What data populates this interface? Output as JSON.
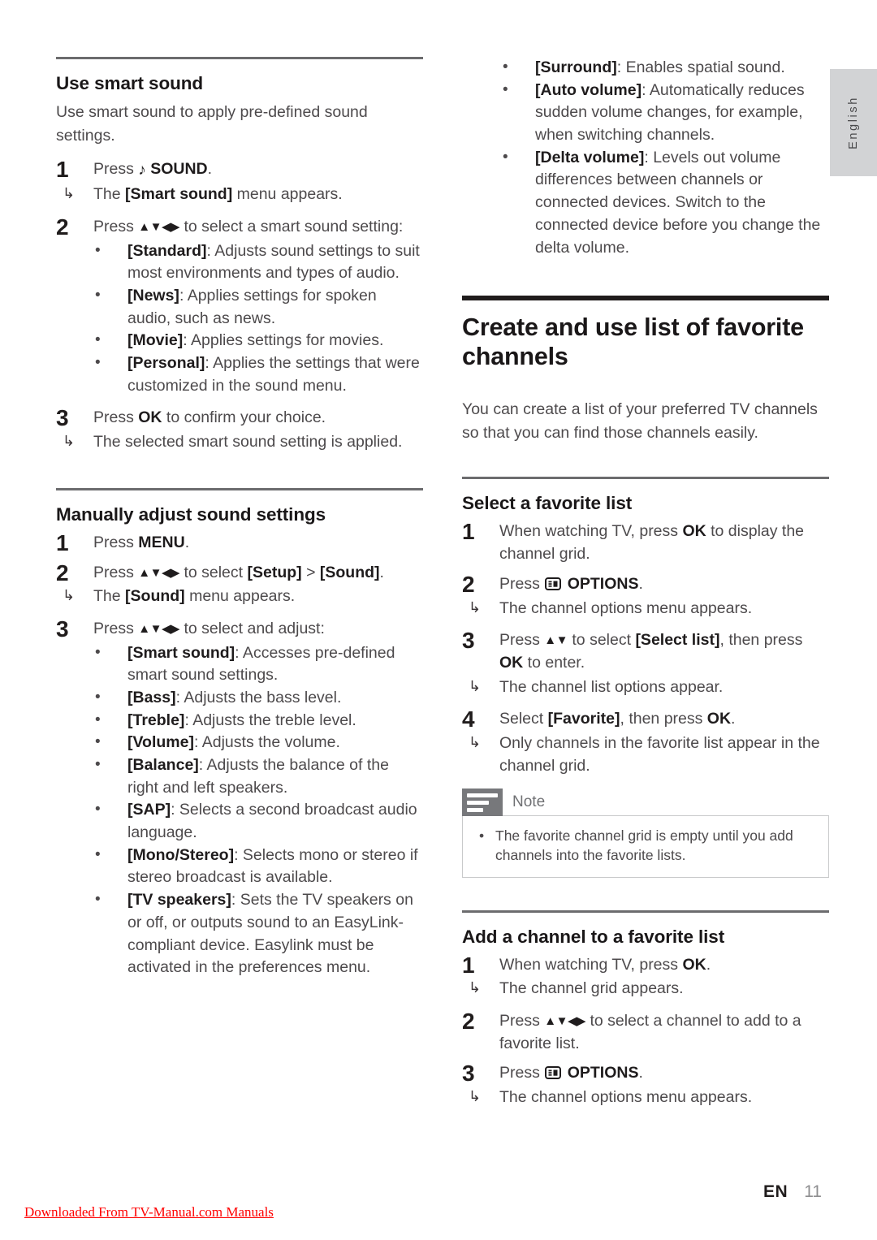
{
  "language_tab": {
    "label": "English"
  },
  "left_column": {
    "section1": {
      "heading": "Use smart sound",
      "intro": "Use smart sound to apply pre-defined sound settings.",
      "steps": [
        {
          "num": "1",
          "text_before": "Press ",
          "icon": "music-note-icon",
          "bold": "SOUND",
          "text_after": ".",
          "result": {
            "pre": "The ",
            "bold": "[Smart sound]",
            "post": " menu appears."
          }
        },
        {
          "num": "2",
          "pre": "Press ",
          "arrows": "▲▼◀▶",
          "post": " to select a smart sound setting:",
          "bullets": [
            {
              "bold": "[Standard]",
              "text": ": Adjusts sound settings to suit most environments and types of audio."
            },
            {
              "bold": "[News]",
              "text": ": Applies settings for spoken audio, such as news."
            },
            {
              "bold": "[Movie]",
              "text": ": Applies settings for movies."
            },
            {
              "bold": "[Personal]",
              "text": ": Applies the settings that were customized in the sound menu."
            }
          ]
        },
        {
          "num": "3",
          "pre": "Press ",
          "bold": "OK",
          "post": " to confirm your choice.",
          "result_plain": "The selected smart sound setting is applied."
        }
      ]
    },
    "section2": {
      "heading": "Manually adjust sound settings",
      "steps": [
        {
          "num": "1",
          "pre": "Press ",
          "bold": "MENU",
          "post": "."
        },
        {
          "num": "2",
          "pre": "Press ",
          "arrows": "▲▼◀▶",
          "mid": " to select ",
          "bold1": "[Setup]",
          "mid2": " > ",
          "bold2": "[Sound]",
          "post": ".",
          "result": {
            "pre": "The ",
            "bold": "[Sound]",
            "post": " menu appears."
          }
        },
        {
          "num": "3",
          "pre": "Press ",
          "arrows": "▲▼◀▶",
          "post": " to select and adjust:",
          "bullets": [
            {
              "bold": "[Smart sound]",
              "text": ": Accesses pre-defined smart sound settings."
            },
            {
              "bold": "[Bass]",
              "text": ": Adjusts the bass level."
            },
            {
              "bold": "[Treble]",
              "text": ": Adjusts the treble level."
            },
            {
              "bold": "[Volume]",
              "text": ": Adjusts the volume."
            },
            {
              "bold": "[Balance]",
              "text": ": Adjusts the balance of the right and left speakers."
            },
            {
              "bold": "[SAP]",
              "text": ": Selects a second broadcast audio language."
            },
            {
              "bold": "[Mono/Stereo]",
              "text": ": Selects mono or stereo if stereo broadcast is available."
            },
            {
              "bold": "[TV speakers]",
              "text": ": Sets the TV speakers on or off, or outputs sound to an EasyLink-compliant device. Easylink must be activated in the preferences menu."
            }
          ]
        }
      ]
    }
  },
  "right_column": {
    "continued_bullets": [
      {
        "bold": "[Surround]",
        "text": ": Enables spatial sound."
      },
      {
        "bold": "[Auto volume]",
        "text": ": Automatically reduces sudden volume changes, for example, when switching channels."
      },
      {
        "bold": "[Delta volume]",
        "text": ": Levels out volume differences between channels or connected devices. Switch to the connected device before you change the delta volume."
      }
    ],
    "section_main": {
      "heading": "Create and use list of favorite channels",
      "intro": "You can create a list of your preferred TV channels so that you can find those channels easily."
    },
    "section3": {
      "heading": "Select a favorite list",
      "steps": [
        {
          "num": "1",
          "pre": "When watching TV, press ",
          "bold": "OK",
          "post": " to display the channel grid."
        },
        {
          "num": "2",
          "pre": "Press ",
          "icon": "options-icon",
          "bold": "OPTIONS",
          "post": ".",
          "result_plain": "The channel options menu appears."
        },
        {
          "num": "3",
          "pre": "Press ",
          "arrows": "▲▼",
          "mid": " to select ",
          "bold1": "[Select list]",
          "mid2": ", then press ",
          "bold2": "OK",
          "post": " to enter.",
          "result_plain": "The channel list options appear."
        },
        {
          "num": "4",
          "pre": "Select ",
          "bold1": "[Favorite]",
          "mid2": ", then press ",
          "bold2": "OK",
          "post": ".",
          "result_plain": "Only channels in the favorite list appear in the channel grid."
        }
      ],
      "note": {
        "label": "Note",
        "items": [
          "The favorite channel grid is empty until you add channels into the favorite lists."
        ]
      }
    },
    "section4": {
      "heading": "Add a channel to a favorite list",
      "steps": [
        {
          "num": "1",
          "pre": "When watching TV, press ",
          "bold": "OK",
          "post": ".",
          "result_plain": "The channel grid appears."
        },
        {
          "num": "2",
          "pre": "Press ",
          "arrows": "▲▼◀▶",
          "post": " to select a channel to add to a favorite list."
        },
        {
          "num": "3",
          "pre": "Press ",
          "icon": "options-icon",
          "bold": "OPTIONS",
          "post": ".",
          "result_plain": "The channel options menu appears."
        }
      ]
    }
  },
  "footer": {
    "lang_code": "EN",
    "page_number": "11",
    "watermark": "Downloaded From TV-Manual.com Manuals"
  }
}
